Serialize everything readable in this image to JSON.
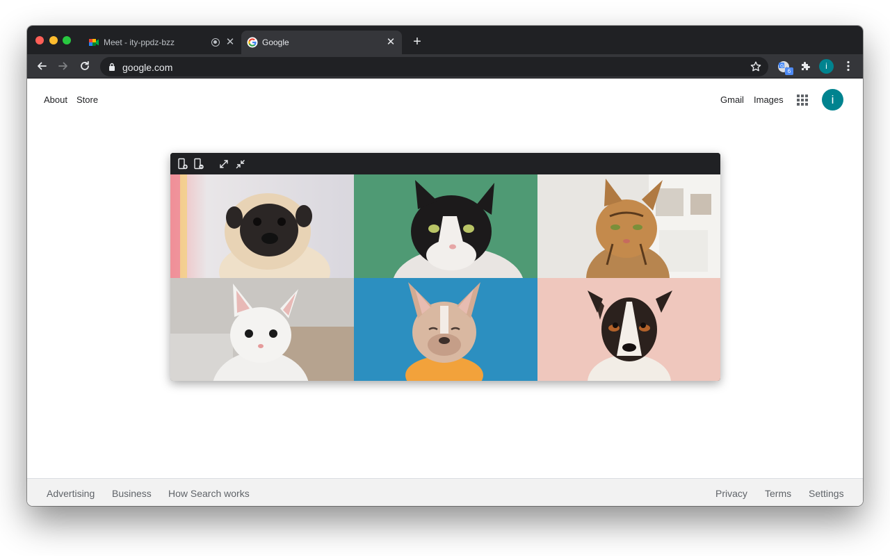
{
  "browser": {
    "tabs": [
      {
        "title": "Meet - ity-ppdz-bzz",
        "favicon": "google-meet-icon",
        "recording": true
      },
      {
        "title": "Google",
        "favicon": "google-g-icon",
        "active": true
      }
    ],
    "address": "google.com",
    "extension_badge": "6",
    "profile_initial": "i"
  },
  "google": {
    "left_links": [
      "About",
      "Store"
    ],
    "right_links": [
      "Gmail",
      "Images"
    ],
    "avatar_initial": "i"
  },
  "pip": {
    "controls": [
      "add-screen-icon",
      "remove-screen-icon",
      "expand-icon",
      "collapse-icon"
    ],
    "tiles": [
      "pug",
      "tuxedo-cat",
      "bengal-cat",
      "white-kitten",
      "french-bulldog",
      "jack-russell-terrier"
    ]
  },
  "footer": {
    "left": [
      "Advertising",
      "Business",
      "How Search works"
    ],
    "right": [
      "Privacy",
      "Terms",
      "Settings"
    ]
  },
  "colors": {
    "tab_strip": "#202124",
    "toolbar": "#35363a",
    "accent_avatar": "#00838f",
    "footer_bg": "#f2f2f2"
  }
}
